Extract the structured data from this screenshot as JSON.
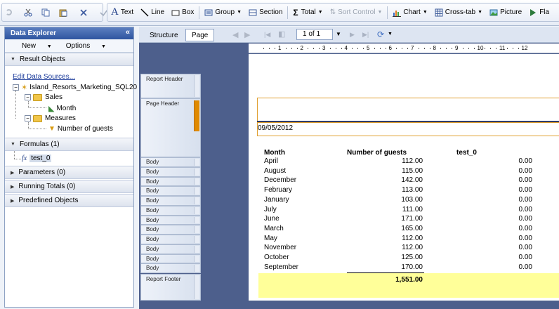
{
  "toolbar": {
    "text": "Text",
    "line": "Line",
    "box": "Box",
    "group": "Group",
    "section": "Section",
    "total": "Total",
    "sort_control": "Sort Control",
    "chart": "Chart",
    "crosstab": "Cross-tab",
    "picture": "Picture",
    "flash": "Fla"
  },
  "explorer": {
    "title": "Data Explorer",
    "new": "New",
    "options": "Options",
    "result_objects": "Result Objects",
    "edit_sources": "Edit Data Sources...",
    "source": "Island_Resorts_Marketing_SQL20",
    "sales": "Sales",
    "month": "Month",
    "measures": "Measures",
    "guests": "Number of guests",
    "formulas": "Formulas (1)",
    "formula1": "test_0",
    "parameters": "Parameters (0)",
    "running_totals": "Running Totals (0)",
    "predefined": "Predefined Objects"
  },
  "tabs": {
    "structure": "Structure",
    "page": "Page"
  },
  "nav": {
    "page_input": "1 of 1"
  },
  "ruler": [
    "1",
    "2",
    "3",
    "4",
    "5",
    "6",
    "7",
    "8",
    "9",
    "10",
    "11",
    "12"
  ],
  "bands": {
    "report_header": "Report Header",
    "page_header": "Page Header",
    "body": "Body",
    "report_footer": "Report Footer"
  },
  "report": {
    "date": "09/05/2012",
    "col_month": "Month",
    "col_guests": "Number of guests",
    "col_test": "test_0",
    "total": "1,551.00",
    "rows": [
      {
        "month": "April",
        "guests": "112.00",
        "test": "0.00"
      },
      {
        "month": "August",
        "guests": "115.00",
        "test": "0.00"
      },
      {
        "month": "December",
        "guests": "142.00",
        "test": "0.00"
      },
      {
        "month": "February",
        "guests": "113.00",
        "test": "0.00"
      },
      {
        "month": "January",
        "guests": "103.00",
        "test": "0.00"
      },
      {
        "month": "July",
        "guests": "111.00",
        "test": "0.00"
      },
      {
        "month": "June",
        "guests": "171.00",
        "test": "0.00"
      },
      {
        "month": "March",
        "guests": "165.00",
        "test": "0.00"
      },
      {
        "month": "May",
        "guests": "112.00",
        "test": "0.00"
      },
      {
        "month": "November",
        "guests": "112.00",
        "test": "0.00"
      },
      {
        "month": "October",
        "guests": "125.00",
        "test": "0.00"
      },
      {
        "month": "September",
        "guests": "170.00",
        "test": "0.00"
      }
    ]
  },
  "colors": {
    "accent": "#e08a00",
    "footer": "#ffff99",
    "header_bar": "#2e55a0"
  }
}
